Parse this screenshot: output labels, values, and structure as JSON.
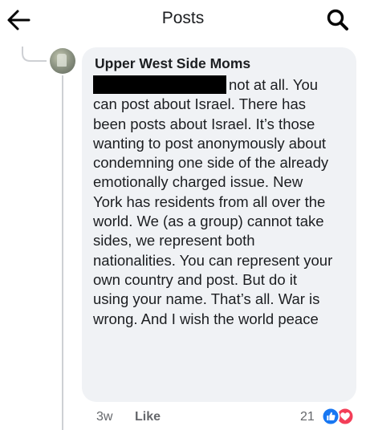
{
  "header": {
    "title": "Posts",
    "back_icon": "back-arrow-icon",
    "search_icon": "search-icon"
  },
  "comment": {
    "author": "Upper West Side Moms",
    "redacted": true,
    "text": "not at all. You can post about Israel. There has been posts about Israel. It’s those wanting to post anonymously about condemning one side of the already emotionally charged issue. New York has residents from all over the world. We (as a group) cannot take sides, we represent both nationalities. You can represent your own country and post. But do it using your name. That’s all. War is wrong. And I wish the world peace",
    "timestamp": "3w",
    "like_label": "Like",
    "reaction_count": "21",
    "reactions": [
      "like-reaction-icon",
      "love-reaction-icon"
    ]
  },
  "colors": {
    "bubble": "#f0f2f5",
    "meta_text": "#65676b",
    "like_blue": "#1877f2",
    "love_red": "#f33e58",
    "thread_line": "#ced0d4"
  }
}
